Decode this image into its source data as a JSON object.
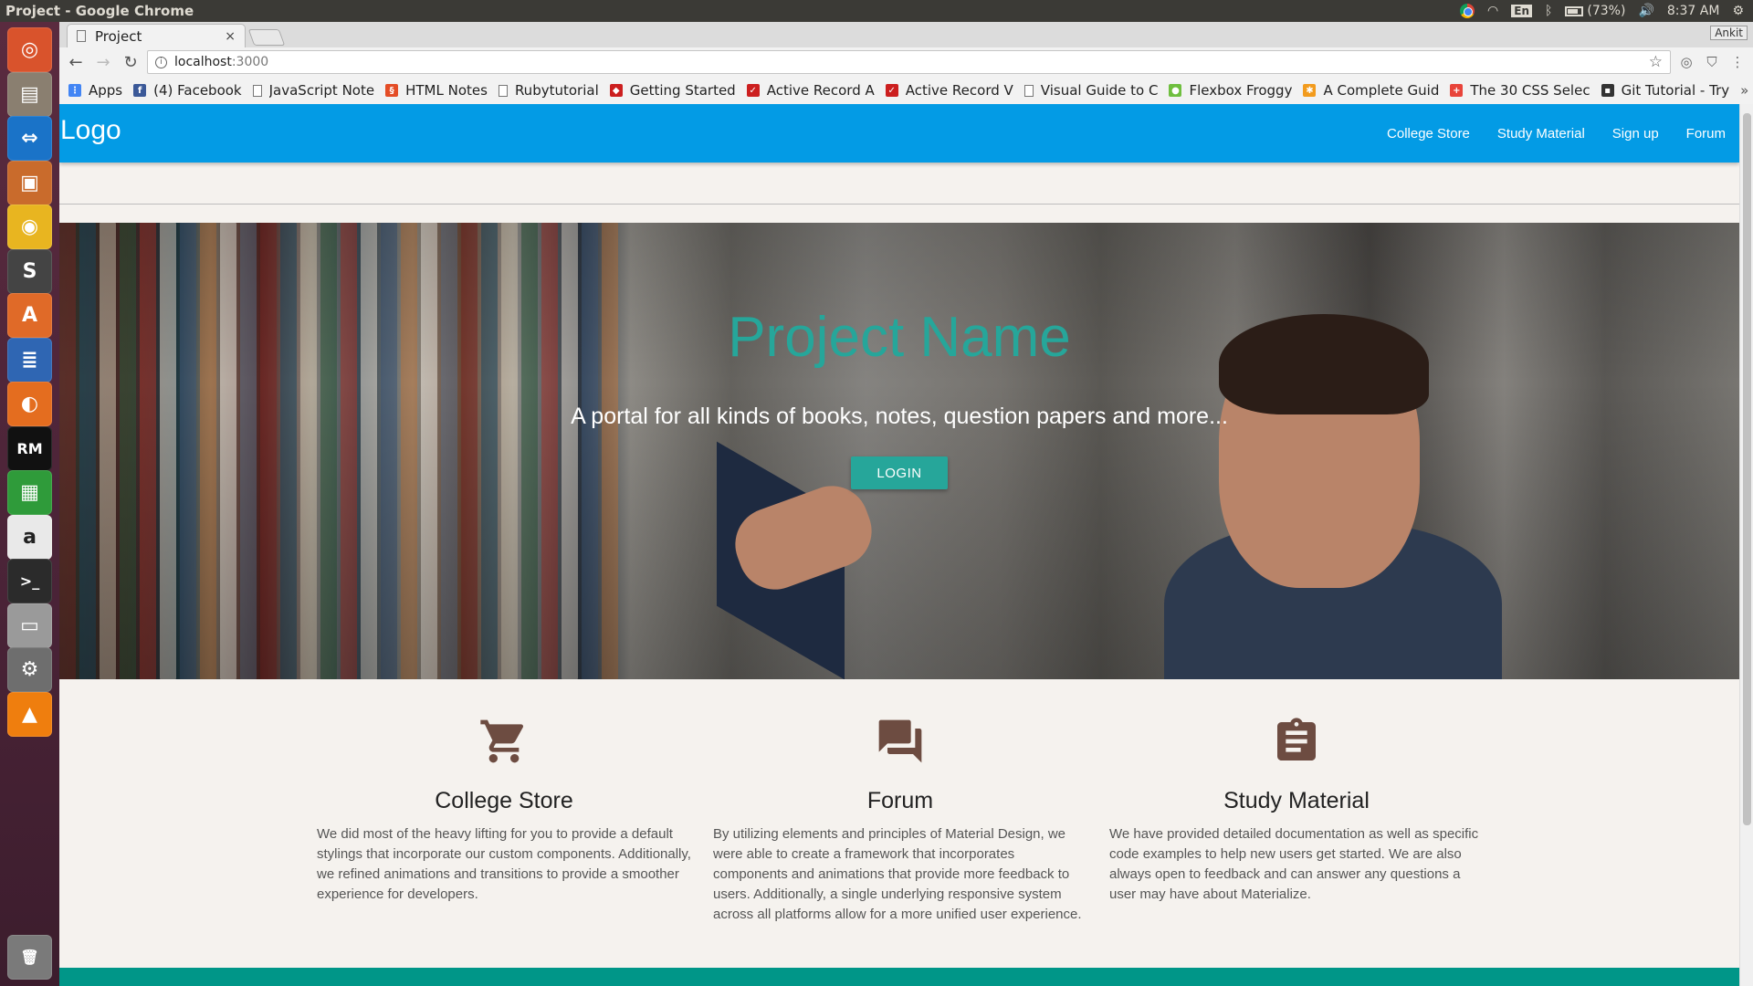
{
  "os": {
    "window_title": "Project - Google Chrome",
    "keyboard": "En",
    "battery": "(73%)",
    "clock": "8:37 AM",
    "user": "Ankit"
  },
  "launcher": {
    "items": [
      {
        "name": "ubuntu-dash-icon",
        "color": "#d9532c",
        "glyph": "◎"
      },
      {
        "name": "files-icon",
        "color": "#8a7f70",
        "glyph": "▤"
      },
      {
        "name": "teamviewer-icon",
        "color": "#1a73c8",
        "glyph": "⇔"
      },
      {
        "name": "presentation-icon",
        "color": "#c96b2c",
        "glyph": "▣"
      },
      {
        "name": "chrome-icon",
        "color": "#e8b520",
        "glyph": "◉"
      },
      {
        "name": "sublime-text-icon",
        "color": "#444444",
        "glyph": "S"
      },
      {
        "name": "software-center-icon",
        "color": "#e06a28",
        "glyph": "A"
      },
      {
        "name": "writer-icon",
        "color": "#2f66b3",
        "glyph": "≣"
      },
      {
        "name": "firefox-icon",
        "color": "#e46d1f",
        "glyph": "◐"
      },
      {
        "name": "rubymine-icon",
        "color": "#111111",
        "glyph": "RM"
      },
      {
        "name": "calc-icon",
        "color": "#2f9b3a",
        "glyph": "▦"
      },
      {
        "name": "amazon-icon",
        "color": "#e9e9e9",
        "glyph": "a"
      },
      {
        "name": "terminal-icon",
        "color": "#2b2b2b",
        "glyph": ">_"
      },
      {
        "name": "drive-icon",
        "color": "#9a9a9a",
        "glyph": "▭"
      },
      {
        "name": "settings-icon",
        "color": "#6e6e6e",
        "glyph": "⚙"
      },
      {
        "name": "vlc-icon",
        "color": "#ef7e0e",
        "glyph": "▲"
      },
      {
        "name": "trash-icon",
        "color": "#7a7a7a",
        "glyph": "🗑"
      }
    ]
  },
  "browser": {
    "tab_title": "Project",
    "tab_close": "×",
    "url_host": "localhost",
    "url_port": ":3000",
    "bookmarks": [
      {
        "label": "Apps",
        "icon": "apps-grid-icon",
        "color": "#4285f4",
        "glyph": "⋮"
      },
      {
        "label": "(4) Facebook",
        "icon": "facebook-icon",
        "color": "#3b5998",
        "glyph": "f"
      },
      {
        "label": "JavaScript Note",
        "icon": "page-icon",
        "color": "#ffffff",
        "glyph": ""
      },
      {
        "label": "HTML Notes",
        "icon": "html-notes-icon",
        "color": "#e44d26",
        "glyph": "§"
      },
      {
        "label": "Rubytutorial",
        "icon": "page-icon",
        "color": "#ffffff",
        "glyph": ""
      },
      {
        "label": "Getting Started",
        "icon": "ruby-icon",
        "color": "#cc1f1f",
        "glyph": "◆"
      },
      {
        "label": "Active Record A",
        "icon": "rails-icon",
        "color": "#cc1f1f",
        "glyph": "✓"
      },
      {
        "label": "Active Record V",
        "icon": "rails-icon",
        "color": "#cc1f1f",
        "glyph": "✓"
      },
      {
        "label": "Visual Guide to C",
        "icon": "page-icon",
        "color": "#ffffff",
        "glyph": ""
      },
      {
        "label": "Flexbox Froggy",
        "icon": "frog-icon",
        "color": "#6fbf3f",
        "glyph": "●"
      },
      {
        "label": "A Complete Guid",
        "icon": "star-burst-icon",
        "color": "#f29b1d",
        "glyph": "✱"
      },
      {
        "label": "The 30 CSS Selec",
        "icon": "plus-box-icon",
        "color": "#e8443a",
        "glyph": "+"
      },
      {
        "label": "Git Tutorial - Try",
        "icon": "git-cat-icon",
        "color": "#333333",
        "glyph": "▪"
      }
    ],
    "more": "»"
  },
  "page": {
    "brand": "Logo",
    "nav": [
      "College Store",
      "Study Material",
      "Sign up",
      "Forum"
    ],
    "hero": {
      "title": "Project Name",
      "subtitle": "A portal for all kinds of books, notes, question papers and more...",
      "button": "LOGIN"
    },
    "features": [
      {
        "icon": "shopping-cart-icon",
        "title": "College Store",
        "text": "We did most of the heavy lifting for you to provide a default stylings that incorporate our custom components. Additionally, we refined animations and transitions to provide a smoother experience for developers."
      },
      {
        "icon": "forum-icon",
        "title": "Forum",
        "text": "By utilizing elements and principles of Material Design, we were able to create a framework that incorporates components and animations that provide more feedback to users. Additionally, a single underlying responsive system across all platforms allow for a more unified user experience."
      },
      {
        "icon": "clipboard-icon",
        "title": "Study Material",
        "text": "We have provided detailed documentation as well as specific code examples to help new users get started. We are also always open to feedback and can answer any questions a user may have about Materialize."
      }
    ],
    "colors": {
      "navbar": "#039be5",
      "accent": "#26a69a",
      "footer": "#009688",
      "icon_brown": "#6d4c41"
    }
  }
}
